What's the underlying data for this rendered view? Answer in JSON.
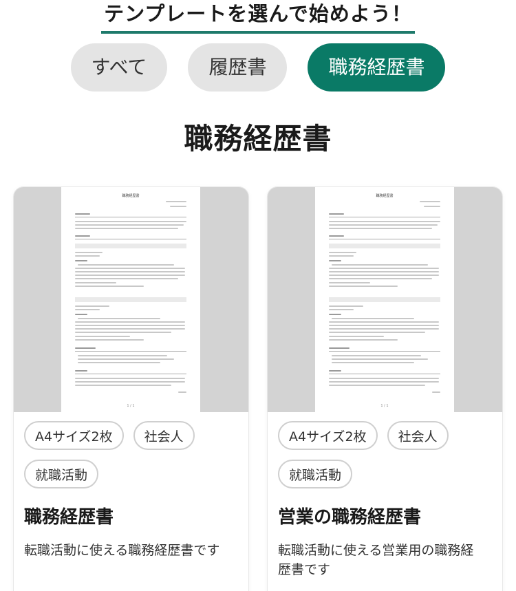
{
  "header": {
    "title": "テンプレートを選んで始めよう！"
  },
  "tabs": [
    {
      "label": "すべて",
      "active": false
    },
    {
      "label": "履歴書",
      "active": false
    },
    {
      "label": "職務経歴書",
      "active": true
    }
  ],
  "section": {
    "heading": "職務経歴書"
  },
  "cards": [
    {
      "preview_doc_title": "職務経歴書",
      "tags": [
        "A4サイズ2枚",
        "社会人",
        "就職活動"
      ],
      "title": "職務経歴書",
      "description": "転職活動に使える職務経歴書です"
    },
    {
      "preview_doc_title": "職務経歴書",
      "tags": [
        "A4サイズ2枚",
        "社会人",
        "就職活動"
      ],
      "title": "営業の職務経歴書",
      "description": "転職活動に使える営業用の職務経歴書です"
    }
  ],
  "colors": {
    "accent": "#0a7a66",
    "underline": "#1e7a6b",
    "tab_inactive": "#e4e4e4",
    "thumb_bg": "#d3d3d3"
  }
}
